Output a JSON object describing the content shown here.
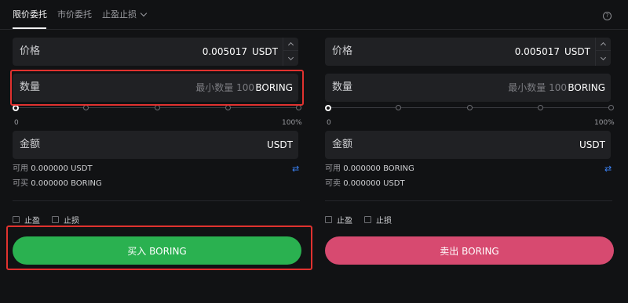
{
  "tabs": [
    {
      "label": "限价委托"
    },
    {
      "label": "市价委托"
    },
    {
      "label": "止盈止损"
    }
  ],
  "help_glyph": "?",
  "buy": {
    "price": {
      "label": "价格",
      "value": "0.005017",
      "unit": "USDT"
    },
    "amount": {
      "label": "数量",
      "placeholder": "最小数量 100",
      "unit": "BORING"
    },
    "slider": {
      "min_label": "0",
      "max_label": "100%",
      "position": 0,
      "marks": 5
    },
    "total": {
      "label": "金额",
      "unit": "USDT"
    },
    "available": {
      "label": "可用",
      "value": "0.000000 USDT"
    },
    "buyable": {
      "label": "可买",
      "value": "0.000000 BORING"
    },
    "take_profit": "止盈",
    "stop_loss": "止损",
    "button": "买入 BORING"
  },
  "sell": {
    "price": {
      "label": "价格",
      "value": "0.005017",
      "unit": "USDT"
    },
    "amount": {
      "label": "数量",
      "placeholder": "最小数量 100",
      "unit": "BORING"
    },
    "slider": {
      "min_label": "0",
      "max_label": "100%",
      "position": 0,
      "marks": 5
    },
    "total": {
      "label": "金额",
      "unit": "USDT"
    },
    "available": {
      "label": "可用",
      "value": "0.000000 BORING"
    },
    "sellable": {
      "label": "可卖",
      "value": "0.000000 USDT"
    },
    "take_profit": "止盈",
    "stop_loss": "止损",
    "button": "卖出 BORING"
  },
  "swap_glyph": "⇄",
  "colors": {
    "background": "#111214",
    "field": "#202124",
    "buy": "#2ab150",
    "sell": "#d74a70",
    "highlight": "#e0322f",
    "swap": "#3b82f6"
  },
  "icons": [
    "chevron-down-icon",
    "help-icon",
    "stepper-up-icon",
    "stepper-down-icon",
    "swap-icon",
    "checkbox-icon"
  ]
}
